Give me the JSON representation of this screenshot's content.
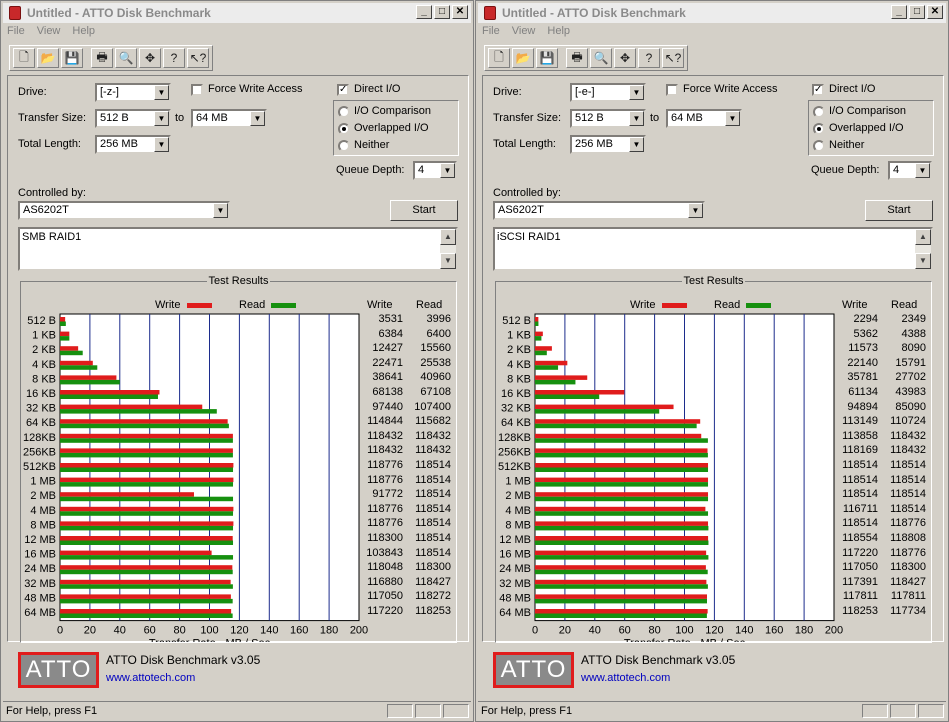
{
  "sizes": [
    "512 B",
    "1 KB",
    "2 KB",
    "4 KB",
    "8 KB",
    "16 KB",
    "32 KB",
    "64 KB",
    "128KB",
    "256KB",
    "512KB",
    "1 MB",
    "2 MB",
    "4 MB",
    "8 MB",
    "12 MB",
    "16 MB",
    "24 MB",
    "32 MB",
    "48 MB",
    "64 MB"
  ],
  "ticks": [
    "0",
    "20",
    "40",
    "60",
    "80",
    "100",
    "120",
    "140",
    "160",
    "180",
    "200"
  ],
  "colors": {
    "write": "#e01c1c",
    "read": "#16900f",
    "grid": "#1c2c8c"
  },
  "windows": [
    {
      "title": "Untitled - ATTO Disk Benchmark",
      "menu": [
        "File",
        "View",
        "Help"
      ],
      "form": {
        "drive_label": "Drive:",
        "drive": "[-z-]",
        "force_write": "Force Write Access",
        "direct_io": "Direct I/O",
        "transfer_label": "Transfer Size:",
        "transfer_from": "512 B",
        "to_label": "to",
        "transfer_to": "64 MB",
        "total_label": "Total Length:",
        "total": "256 MB",
        "io_comparison": "I/O Comparison",
        "overlapped": "Overlapped I/O",
        "neither": "Neither",
        "queue_label": "Queue Depth:",
        "queue": "4",
        "controlled_label": "Controlled by:",
        "controlled": "AS6202T",
        "start": "Start",
        "notes": "SMB RAID1"
      },
      "results_title": "Test Results",
      "write_label": "Write",
      "read_label": "Read",
      "xlabel": "Transfer Rate - MB / Sec",
      "write": [
        "3531",
        "6384",
        "12427",
        "22471",
        "38641",
        "68138",
        "97440",
        "114844",
        "118432",
        "118432",
        "118776",
        "118776",
        "91772",
        "118776",
        "118776",
        "118300",
        "103843",
        "118048",
        "116880",
        "117050",
        "117220"
      ],
      "read": [
        "3996",
        "6400",
        "15560",
        "25538",
        "40960",
        "67108",
        "107400",
        "115682",
        "118432",
        "118432",
        "118514",
        "118514",
        "118514",
        "118514",
        "118514",
        "118514",
        "118514",
        "118300",
        "118427",
        "118272",
        "118253"
      ],
      "version": "ATTO Disk Benchmark v3.05",
      "url": "www.attotech.com",
      "logo": "ATTO",
      "status": "For Help, press F1"
    },
    {
      "title": "Untitled - ATTO Disk Benchmark",
      "menu": [
        "File",
        "View",
        "Help"
      ],
      "form": {
        "drive_label": "Drive:",
        "drive": "[-e-]",
        "force_write": "Force Write Access",
        "direct_io": "Direct I/O",
        "transfer_label": "Transfer Size:",
        "transfer_from": "512 B",
        "to_label": "to",
        "transfer_to": "64 MB",
        "total_label": "Total Length:",
        "total": "256 MB",
        "io_comparison": "I/O Comparison",
        "overlapped": "Overlapped I/O",
        "neither": "Neither",
        "queue_label": "Queue Depth:",
        "queue": "4",
        "controlled_label": "Controlled by:",
        "controlled": "AS6202T",
        "start": "Start",
        "notes": "iSCSI RAID1"
      },
      "results_title": "Test Results",
      "write_label": "Write",
      "read_label": "Read",
      "xlabel": "Transfer Rate - MB / Sec",
      "write": [
        "2294",
        "5362",
        "11573",
        "22140",
        "35781",
        "61134",
        "94894",
        "113149",
        "113858",
        "118169",
        "118514",
        "118514",
        "118514",
        "116711",
        "118514",
        "118554",
        "117220",
        "117050",
        "117391",
        "117811",
        "118253"
      ],
      "read": [
        "2349",
        "4388",
        "8090",
        "15791",
        "27702",
        "43983",
        "85090",
        "110724",
        "118432",
        "118432",
        "118514",
        "118514",
        "118514",
        "118514",
        "118776",
        "118808",
        "118776",
        "118300",
        "118427",
        "117811",
        "117734"
      ],
      "version": "ATTO Disk Benchmark v3.05",
      "url": "www.attotech.com",
      "logo": "ATTO",
      "status": "For Help, press F1"
    }
  ]
}
